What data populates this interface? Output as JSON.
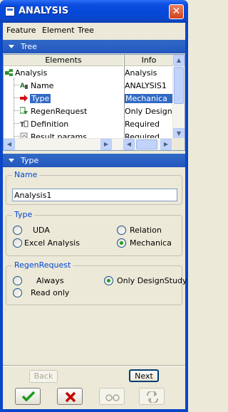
{
  "window": {
    "title": "ANALYSIS"
  },
  "menu": [
    "Feature",
    "Element",
    "Tree"
  ],
  "tree_section": {
    "label": "Tree"
  },
  "tree": {
    "columns": [
      "Elements",
      "Info"
    ],
    "rows": [
      {
        "name": "Analysis",
        "info": "Analysis",
        "icon": "analysis-icon",
        "selected": false
      },
      {
        "name": "Name",
        "info": "ANALYSIS1",
        "icon": "name-icon",
        "selected": false
      },
      {
        "name": "Type",
        "info": "Mechanica",
        "icon": "arrow-right-icon",
        "selected": true
      },
      {
        "name": "RegenRequest",
        "info": "Only DesignSt",
        "icon": "regen-icon",
        "selected": false
      },
      {
        "name": "Definition",
        "info": "Required",
        "icon": "definition-icon",
        "selected": false
      },
      {
        "name": "Result params",
        "info": "Required",
        "icon": "result-params-icon",
        "selected": false
      }
    ]
  },
  "type_section": {
    "label": "Type"
  },
  "name_group": {
    "title": "Name",
    "value": "Analysis1"
  },
  "type_group": {
    "title": "Type",
    "options": [
      {
        "label": "UDA",
        "checked": false
      },
      {
        "label": "Relation",
        "checked": false
      },
      {
        "label": "Excel Analysis",
        "checked": false
      },
      {
        "label": "Mechanica",
        "checked": true
      }
    ]
  },
  "regen_group": {
    "title": "RegenRequest",
    "options": [
      {
        "label": "Always",
        "checked": false
      },
      {
        "label": "Only DesignStudy",
        "checked": true
      },
      {
        "label": "Read only",
        "checked": false
      }
    ]
  },
  "nav": {
    "back": "Back",
    "next": "Next"
  },
  "icons": {
    "ok": "check-icon",
    "cancel": "x-icon",
    "preview": "glasses-icon",
    "repaint": "repaint-icon"
  },
  "colors": {
    "title_bar": "#0548d9",
    "section_header": "#3169c6",
    "selection": "#316ac5",
    "group_title": "#0046d5",
    "ok": "#1e9a1e",
    "cancel": "#c40000"
  }
}
